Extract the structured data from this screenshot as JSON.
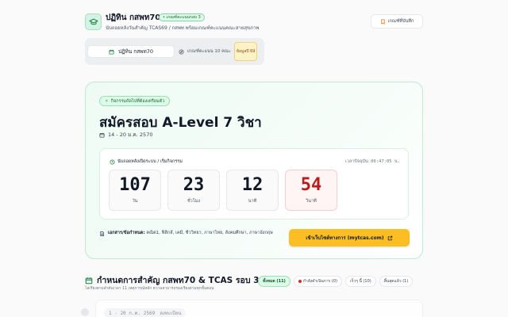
{
  "header": {
    "title": "ปฏิทิน กสพท70",
    "badge": "• เกณฑ์คะแนนรอบ 3",
    "subtitle": "นับถอยหลังวันสำคัญ TCAS69 / กสพท พร้อมเกณฑ์คะแนนคณะสายสุขภาพ",
    "saved_label": "เกณฑ์ที่บันทึก"
  },
  "tabs": {
    "calendar_label": "ปฏิทิน กสพท70",
    "criteria_label": "เกณฑ์คะแนน 10 คณะ",
    "criteria_tag": "ข้อมูลปี 69"
  },
  "event": {
    "pill_label": "กิจกรรมถัดไปที่ต้องเตรียมตัว",
    "title": "สมัครสอบ A-Level 7 วิชา",
    "date_range": "14 - 20 ม.ค. 2570",
    "countdown_label": "นับถอยหลังเปิดระบบ / เริ่มกิจกรรม",
    "now_label": "เวลาปัจจุบัน:",
    "now_time": "00:47:05 น.",
    "countdown": [
      {
        "value": "107",
        "unit": "วัน"
      },
      {
        "value": "23",
        "unit": "ชั่วโมง"
      },
      {
        "value": "12",
        "unit": "นาที"
      },
      {
        "value": "54",
        "unit": "วินาที"
      }
    ],
    "docs_label": "เอกสาร/ข้อกำหนด:",
    "docs_text": "คณิต1, ฟิสิกส์, เคมี, ชีววิทยา, ภาษาไทย, สังคมศึกษา, ภาษาอังกฤษ",
    "visit_label": "เข้าเว็บไซต์ทางการ (mytcas.com)"
  },
  "schedule": {
    "title": "กำหนดการสำคัญ กสพท70 & TCAS รอบ 3",
    "subtitle": "ไล่เรียงตามลำดับเวลา 11 เหตุการณ์หลัก ความสามารถรองเรียงตามทุกขั้นตอน",
    "filters": [
      {
        "label": "ทั้งหมด (11)"
      },
      {
        "label": "กำลังดำเนินการ (0)"
      },
      {
        "label": "เร็วๆ นี้ (10)"
      },
      {
        "label": "สิ้นสุดแล้ว (1)"
      }
    ],
    "first_item_date": "1 - 20 ก.ค. 2569",
    "first_item_tag": "ลงทะเบียน"
  },
  "colors": {
    "accent": "#16a34a",
    "button_yellow": "#fbbf24",
    "seconds_red": "#b91c1c"
  }
}
